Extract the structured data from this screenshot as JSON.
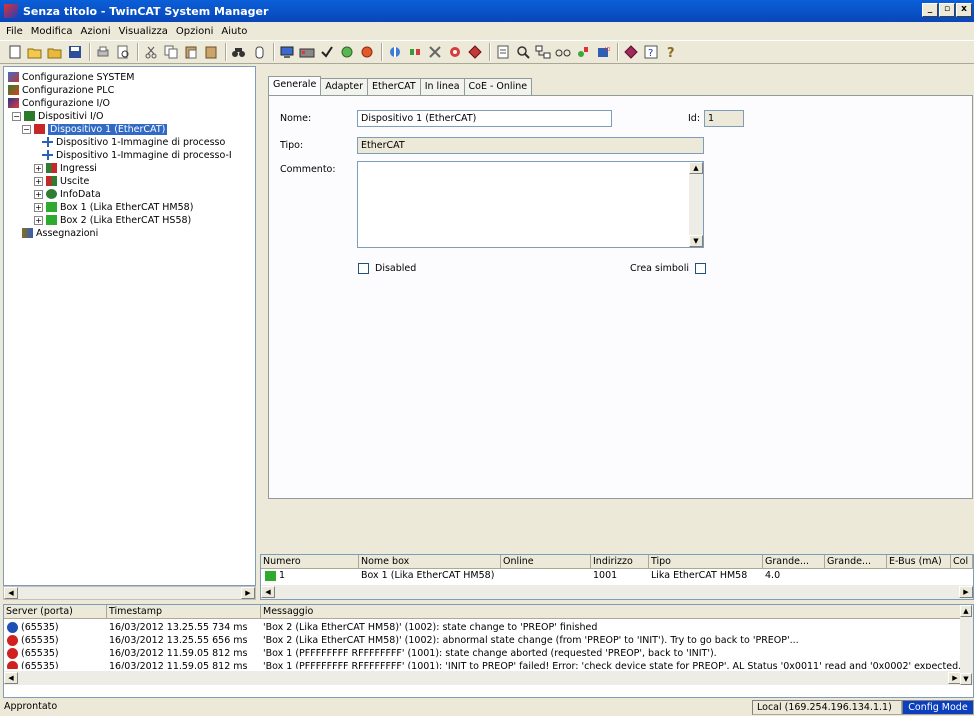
{
  "window": {
    "title": "Senza titolo - TwinCAT System Manager",
    "controls": [
      "_",
      "▫",
      "x"
    ]
  },
  "menu": [
    "File",
    "Modifica",
    "Azioni",
    "Visualizza",
    "Opzioni",
    "Aiuto"
  ],
  "tree": {
    "items": [
      {
        "label": "Configurazione SYSTEM"
      },
      {
        "label": "Configurazione PLC"
      },
      {
        "label": "Configurazione I/O"
      },
      {
        "label": "Dispositivi I/O"
      },
      {
        "label": "Dispositivo 1 (EtherCAT)"
      },
      {
        "label": "Dispositivo 1-Immagine di processo"
      },
      {
        "label": "Dispositivo 1-Immagine di processo-I"
      },
      {
        "label": "Ingressi"
      },
      {
        "label": "Uscite"
      },
      {
        "label": "InfoData"
      },
      {
        "label": "Box 1 (Lika EtherCAT HM58)"
      },
      {
        "label": "Box 2 (Lika EtherCAT HS58)"
      },
      {
        "label": "Assegnazioni"
      }
    ]
  },
  "tabs": [
    "Generale",
    "Adapter",
    "EtherCAT",
    "In linea",
    "CoE - Online"
  ],
  "form": {
    "name_label": "Nome:",
    "name_value": "Dispositivo 1 (EtherCAT)",
    "id_label": "Id:",
    "id_value": "1",
    "type_label": "Tipo:",
    "type_value": "EtherCAT",
    "comment_label": "Commento:",
    "comment_value": "",
    "disabled_label": "Disabled",
    "symbols_label": "Crea simboli"
  },
  "grid": {
    "columns": [
      "Numero",
      "Nome box",
      "Online",
      "Indirizzo",
      "Tipo",
      "Grande...",
      "Grande...",
      "E-Bus (mA)",
      "Col"
    ],
    "rows": [
      {
        "numero": "1",
        "nome": "Box 1 (Lika EtherCAT HM58)",
        "online": "",
        "indirizzo": "1001",
        "tipo": "Lika EtherCAT HM58",
        "grande": "4.0"
      }
    ]
  },
  "log": {
    "columns": [
      "Server (porta)",
      "Timestamp",
      "Messaggio"
    ],
    "rows": [
      {
        "severity": "info",
        "server": "(65535)",
        "timestamp": "16/03/2012 13.25.55 734 ms",
        "message": "'Box 2 (Lika EtherCAT HM58)' (1002): state change to 'PREOP' finished"
      },
      {
        "severity": "error",
        "server": "(65535)",
        "timestamp": "16/03/2012 13.25.55 656 ms",
        "message": "'Box 2 (Lika EtherCAT HM58)' (1002): abnormal state change (from 'PREOP' to 'INIT'). Try to go back to 'PREOP'..."
      },
      {
        "severity": "error",
        "server": "(65535)",
        "timestamp": "16/03/2012 11.59.05 812 ms",
        "message": "'Box 1 (PFFFFFFFF RFFFFFFFF' (1001): state change aborted (requested 'PREOP', back to 'INIT')."
      },
      {
        "severity": "error",
        "server": "(65535)",
        "timestamp": "16/03/2012 11.59.05 812 ms",
        "message": "'Box 1 (PFFFFFFFF RFFFFFFFF' (1001): 'INIT to PREOP' failed! Error: 'check device state for PREOP'. AL Status '0x0011' read and '0x0002' expected. AL S"
      }
    ]
  },
  "status": {
    "left": "Approntato",
    "address": "Local (169.254.196.134.1.1)",
    "mode": "Config Mode"
  },
  "colors": {
    "title": "#0a5fd8",
    "selection": "#316ac5",
    "config_mode": "#0b3fbf"
  }
}
